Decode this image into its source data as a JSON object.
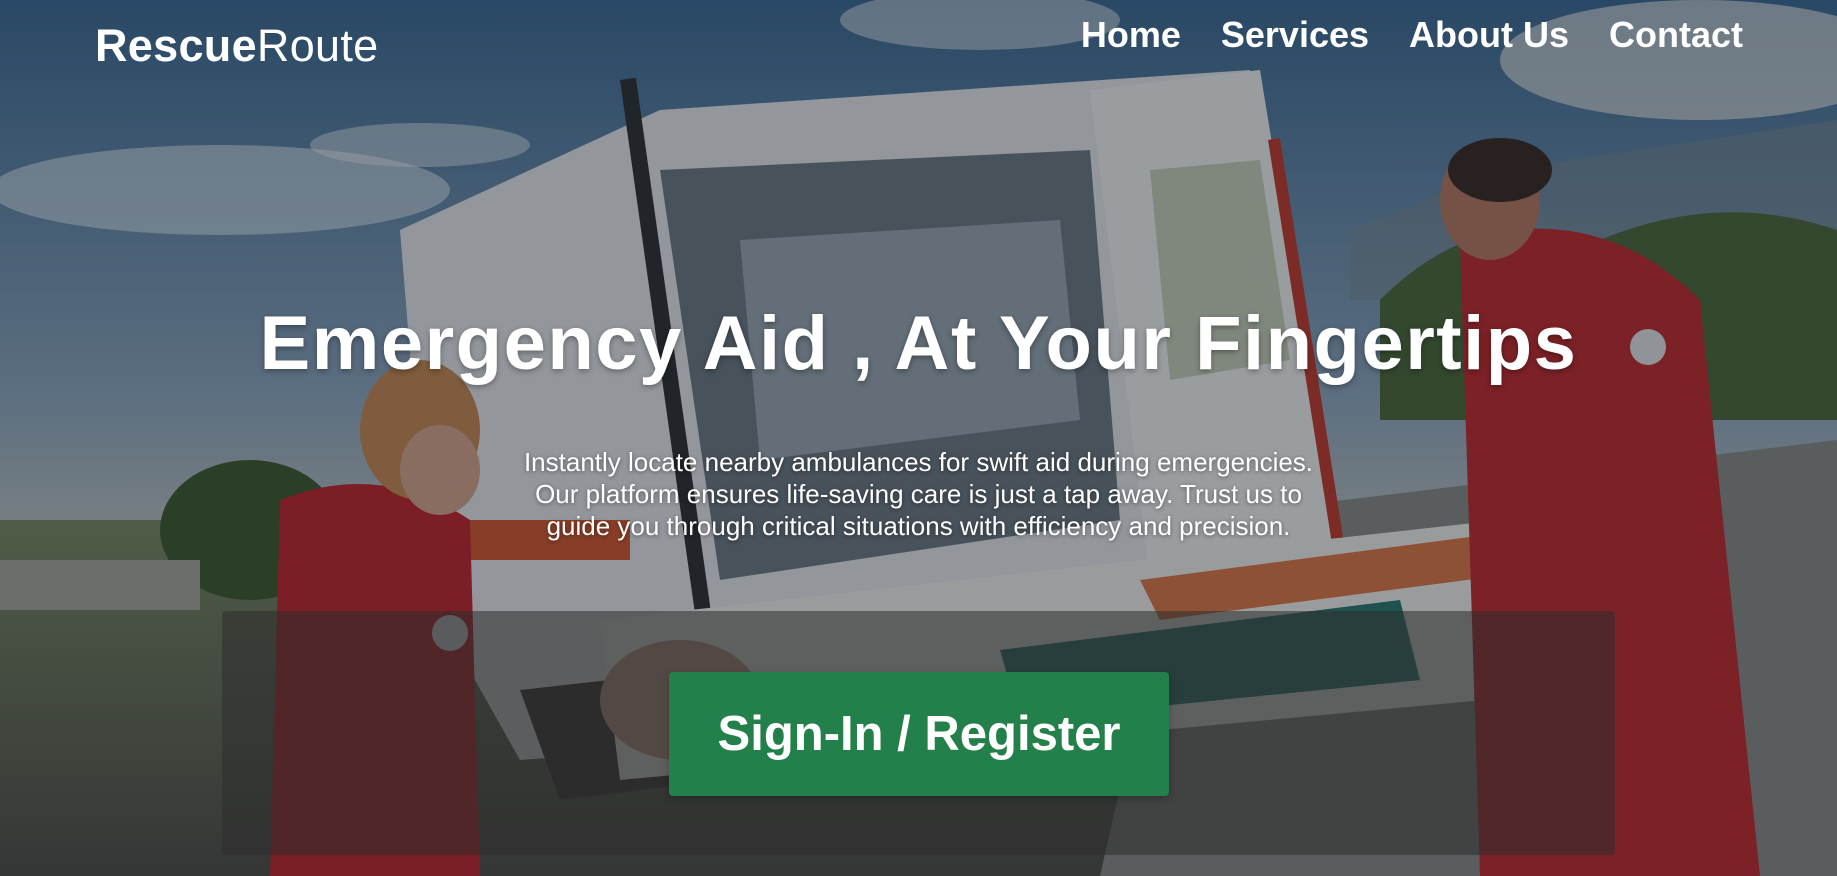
{
  "brand": {
    "name_bold": "Rescue",
    "name_light": "Route"
  },
  "nav": {
    "items": [
      {
        "label": "Home"
      },
      {
        "label": "Services"
      },
      {
        "label": "About Us"
      },
      {
        "label": "Contact"
      }
    ]
  },
  "hero": {
    "headline": "Emergency Aid , At Your Fingertips",
    "subtitle": "Instantly locate nearby ambulances for swift aid during emergencies. Our platform ensures life-saving care is just a tap away. Trust us to guide you through critical situations with efficiency and precision.",
    "cta_label": "Sign-In / Register"
  },
  "colors": {
    "cta_green": "#23804a",
    "text": "#ffffff",
    "panel": "rgba(45,45,45,0.55)"
  }
}
